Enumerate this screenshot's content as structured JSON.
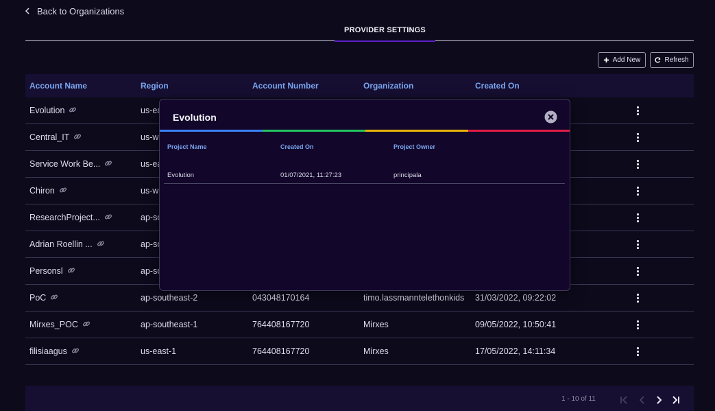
{
  "nav": {
    "back_label": "Back to Organizations"
  },
  "tabs": {
    "active_label": "PROVIDER SETTINGS"
  },
  "toolbar": {
    "add_label": "Add New",
    "refresh_label": "Refresh"
  },
  "table": {
    "headers": [
      "Account Name",
      "Region",
      "Account Number",
      "Organization",
      "Created On"
    ],
    "rows": [
      {
        "name": "Evolution",
        "region": "us-ea",
        "account": "",
        "organization": "",
        "created": ""
      },
      {
        "name": "Central_IT",
        "region": "us-w",
        "account": "",
        "organization": "",
        "created": ""
      },
      {
        "name": "Service Work Be...",
        "region": "us-ea",
        "account": "",
        "organization": "",
        "created": ""
      },
      {
        "name": "Chiron",
        "region": "us-w",
        "account": "",
        "organization": "",
        "created": ""
      },
      {
        "name": "ResearchProject...",
        "region": "ap-so",
        "account": "",
        "organization": "",
        "created": ""
      },
      {
        "name": "Adrian Roellin ...",
        "region": "ap-so",
        "account": "",
        "organization": "",
        "created": ""
      },
      {
        "name": "Personsl",
        "region": "ap-so",
        "account": "",
        "organization": "",
        "created": ""
      },
      {
        "name": "PoC",
        "region": "ap-southeast-2",
        "account": "043048170164",
        "organization": "timo.lassmanntelethonkids",
        "created": "31/03/2022, 09:22:02"
      },
      {
        "name": "Mirxes_POC",
        "region": "ap-southeast-1",
        "account": "764408167720",
        "organization": "Mirxes",
        "created": "09/05/2022, 10:50:41"
      },
      {
        "name": "filisiaagus",
        "region": "us-east-1",
        "account": "764408167720",
        "organization": "Mirxes",
        "created": "17/05/2022, 14:11:34"
      }
    ]
  },
  "pagination": {
    "info": "1 - 10 of 11"
  },
  "modal": {
    "title": "Evolution",
    "headers": [
      "Project Name",
      "Created On",
      "Project Owner"
    ],
    "rows": [
      {
        "project": "Evolution",
        "created": "01/07/2021, 11:27:23",
        "owner": "principala"
      }
    ],
    "stripe_colors": [
      "#3b82f6",
      "#22c55e",
      "#eab308",
      "#e11d48"
    ]
  },
  "colors": {
    "accent": "#5b21c9",
    "header_text": "#7aa5ee",
    "background": "#0d0a1c"
  }
}
